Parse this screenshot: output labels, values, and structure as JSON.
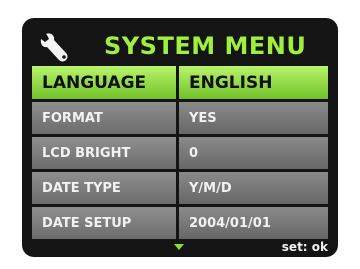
{
  "header": {
    "title": "SYSTEM MENU",
    "icon": "wrench-icon"
  },
  "menu": [
    {
      "label": "LANGUAGE",
      "value": "ENGLISH",
      "selected": true
    },
    {
      "label": "FORMAT",
      "value": "YES"
    },
    {
      "label": "LCD BRIGHT",
      "value": "0"
    },
    {
      "label": "DATE TYPE",
      "value": "Y/M/D"
    },
    {
      "label": "DATE SETUP",
      "value": "2004/01/01"
    }
  ],
  "footer": {
    "set_hint": "set: ok",
    "more_icon": "triangle-down-icon"
  },
  "colors": {
    "accent": "#9ff03e",
    "selected_bg": "#8fdc3c",
    "row_bg": "#7a7a7a",
    "screen_bg": "#141414"
  }
}
